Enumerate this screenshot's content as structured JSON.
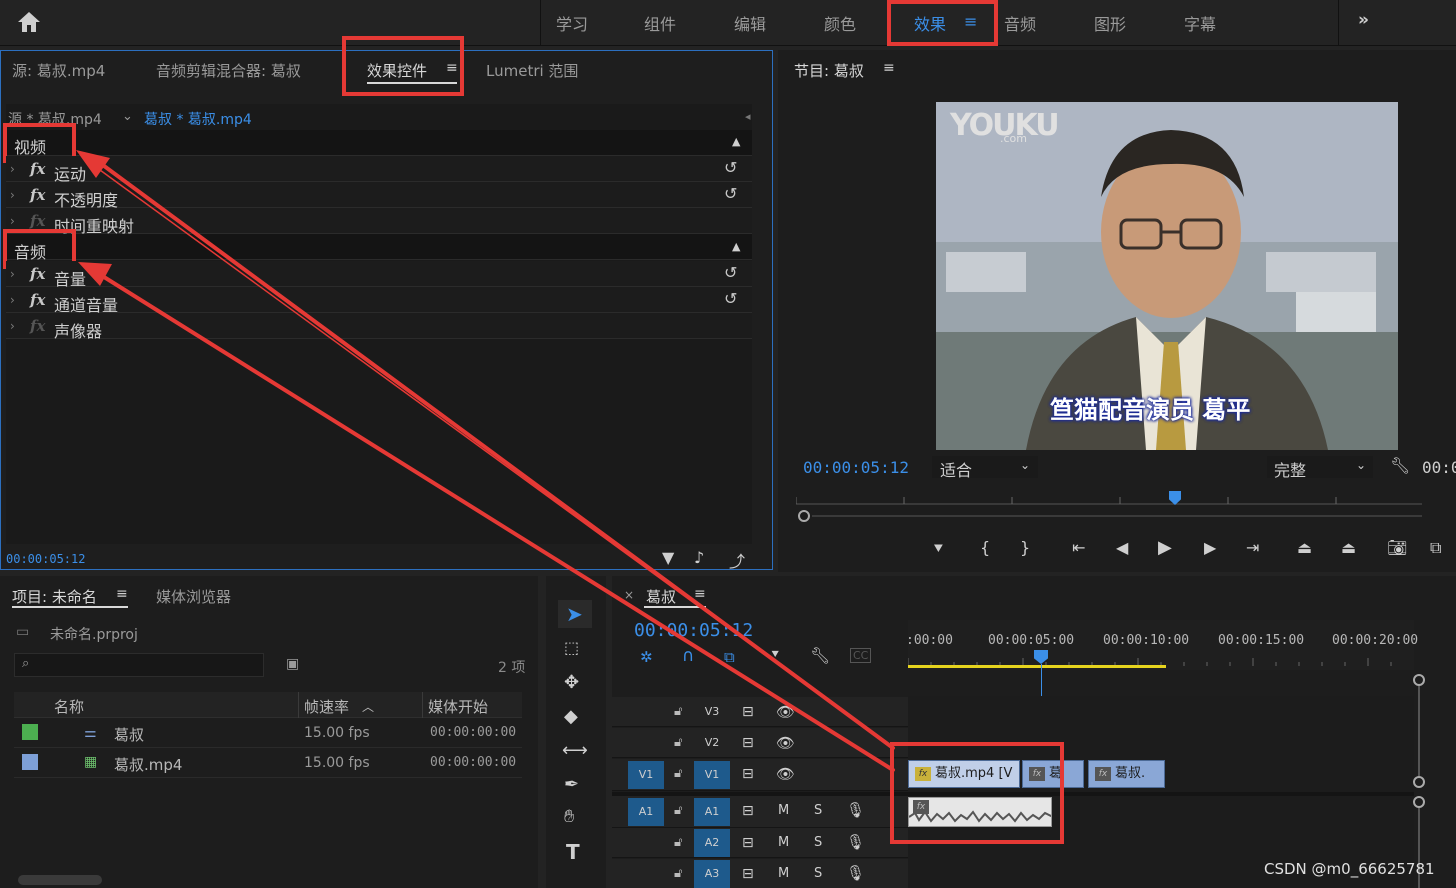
{
  "workspace": {
    "items": [
      "学习",
      "组件",
      "编辑",
      "颜色",
      "效果",
      "音频",
      "图形",
      "字幕"
    ],
    "active": "效果",
    "more": "»"
  },
  "source_panel": {
    "tabs": [
      "源: 葛叔.mp4",
      "音频剪辑混合器: 葛叔",
      "效果控件",
      "Lumetri 范围"
    ],
    "active_tab": "效果控件",
    "clip_tabs": [
      "源 * 葛叔.mp4",
      "葛叔 * 葛叔.mp4"
    ],
    "sections": {
      "video": "视频",
      "audio": "音频"
    },
    "video_effects": [
      "运动",
      "不透明度",
      "时间重映射"
    ],
    "audio_effects": [
      "音量",
      "通道音量",
      "声像器"
    ],
    "timecode": "00:00:05:12"
  },
  "program": {
    "title": "节目: 葛叔",
    "timecode": "00:00:05:12",
    "fit": "适合",
    "quality": "完整",
    "partial_tc": "00:0",
    "watermark": "YOUKU",
    "watermark_sub": ".com",
    "subtitle": "笪猫配音演员 葛平"
  },
  "project": {
    "tabs": [
      "项目: 未命名",
      "媒体浏览器"
    ],
    "file": "未命名.prproj",
    "item_count": "2 项",
    "columns": [
      "名称",
      "帧速率",
      "媒体开始"
    ],
    "rows": [
      {
        "name": "葛叔",
        "fps": "15.00 fps",
        "start": "00:00:00:00",
        "color": "#4caf50"
      },
      {
        "name": "葛叔.mp4",
        "fps": "15.00 fps",
        "start": "00:00:00:00",
        "color": "#7d9fd6"
      }
    ]
  },
  "timeline": {
    "title": "葛叔",
    "timecode": "00:00:05:12",
    "ruler": [
      ":00:00",
      "00:00:05:00",
      "00:00:10:00",
      "00:00:15:00",
      "00:00:20:00"
    ],
    "video_tracks": [
      "V3",
      "V2",
      "V1"
    ],
    "audio_tracks": [
      "A1",
      "A2",
      "A3"
    ],
    "clips": [
      "葛叔.mp4 [V",
      "葛",
      "葛叔."
    ],
    "source_v": "V1",
    "source_a": "A1"
  },
  "watermark_text": "CSDN @m0_66625781",
  "colors": {
    "accent": "#3b8fe8",
    "highlight_box": "#e53935"
  }
}
